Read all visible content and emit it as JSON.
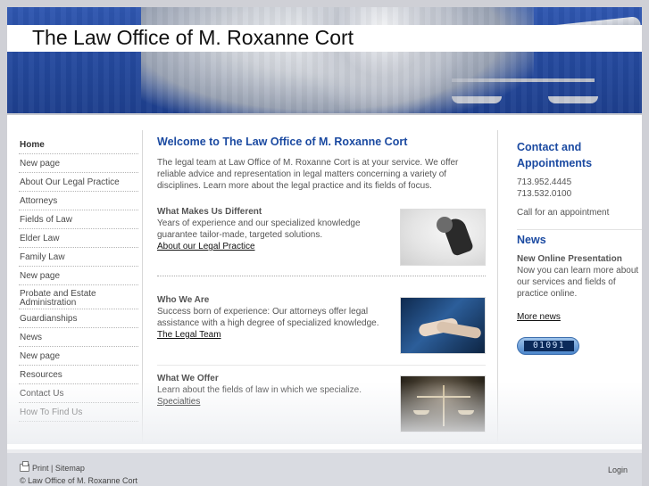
{
  "site": {
    "title": "The Law Office of M. Roxanne Cort"
  },
  "nav": {
    "items": [
      {
        "label": "Home",
        "active": true
      },
      {
        "label": "New page"
      },
      {
        "label": "About Our Legal Practice"
      },
      {
        "label": "Attorneys"
      },
      {
        "label": "Fields of Law"
      },
      {
        "label": "Elder Law"
      },
      {
        "label": "Family Law"
      },
      {
        "label": "New page"
      },
      {
        "label": "Probate and Estate Administration"
      },
      {
        "label": "Guardianships"
      },
      {
        "label": "News"
      },
      {
        "label": "New page"
      },
      {
        "label": "Resources"
      },
      {
        "label": "Contact Us"
      },
      {
        "label": "How To Find Us"
      }
    ]
  },
  "main": {
    "heading": "Welcome to The Law Office of M. Roxanne Cort",
    "intro": "The legal team at Law Office of M. Roxanne Cort is at your service. We offer reliable advice and representation in legal matters concerning a variety of disciplines. Learn more about the legal practice and its fields of focus.",
    "sections": [
      {
        "title": "What Makes Us Different",
        "text": "Years of experience and our specialized knowledge guarantee tailor-made, targeted solutions.",
        "link": "About our Legal Practice"
      },
      {
        "title": "Who We Are",
        "text": "Success born of experience: Our attorneys offer legal assistance with a high degree of specialized knowledge.",
        "link": "The Legal Team"
      },
      {
        "title": "What We Offer",
        "text": "Learn about the fields of law in which we specialize.",
        "link": "Specialties"
      }
    ]
  },
  "sidebar": {
    "contact_heading": "Contact and Appointments",
    "phone1": "713.952.4445",
    "phone2": "713.532.0100",
    "call_text": "Call for an appointment",
    "news_heading": "News",
    "news_title": "New Online Presentation",
    "news_text": "Now you can learn more about our services and fields of practice online.",
    "more_news": "More news",
    "counter": "01091"
  },
  "footer": {
    "print": "Print",
    "separator": "|",
    "sitemap": "Sitemap",
    "copyright": "© Law Office of M. Roxanne Cort",
    "login": "Login"
  },
  "colors": {
    "accent": "#1b4aa1",
    "header_blue": "#254a9f",
    "footer_bg": "#d9dbe1"
  }
}
